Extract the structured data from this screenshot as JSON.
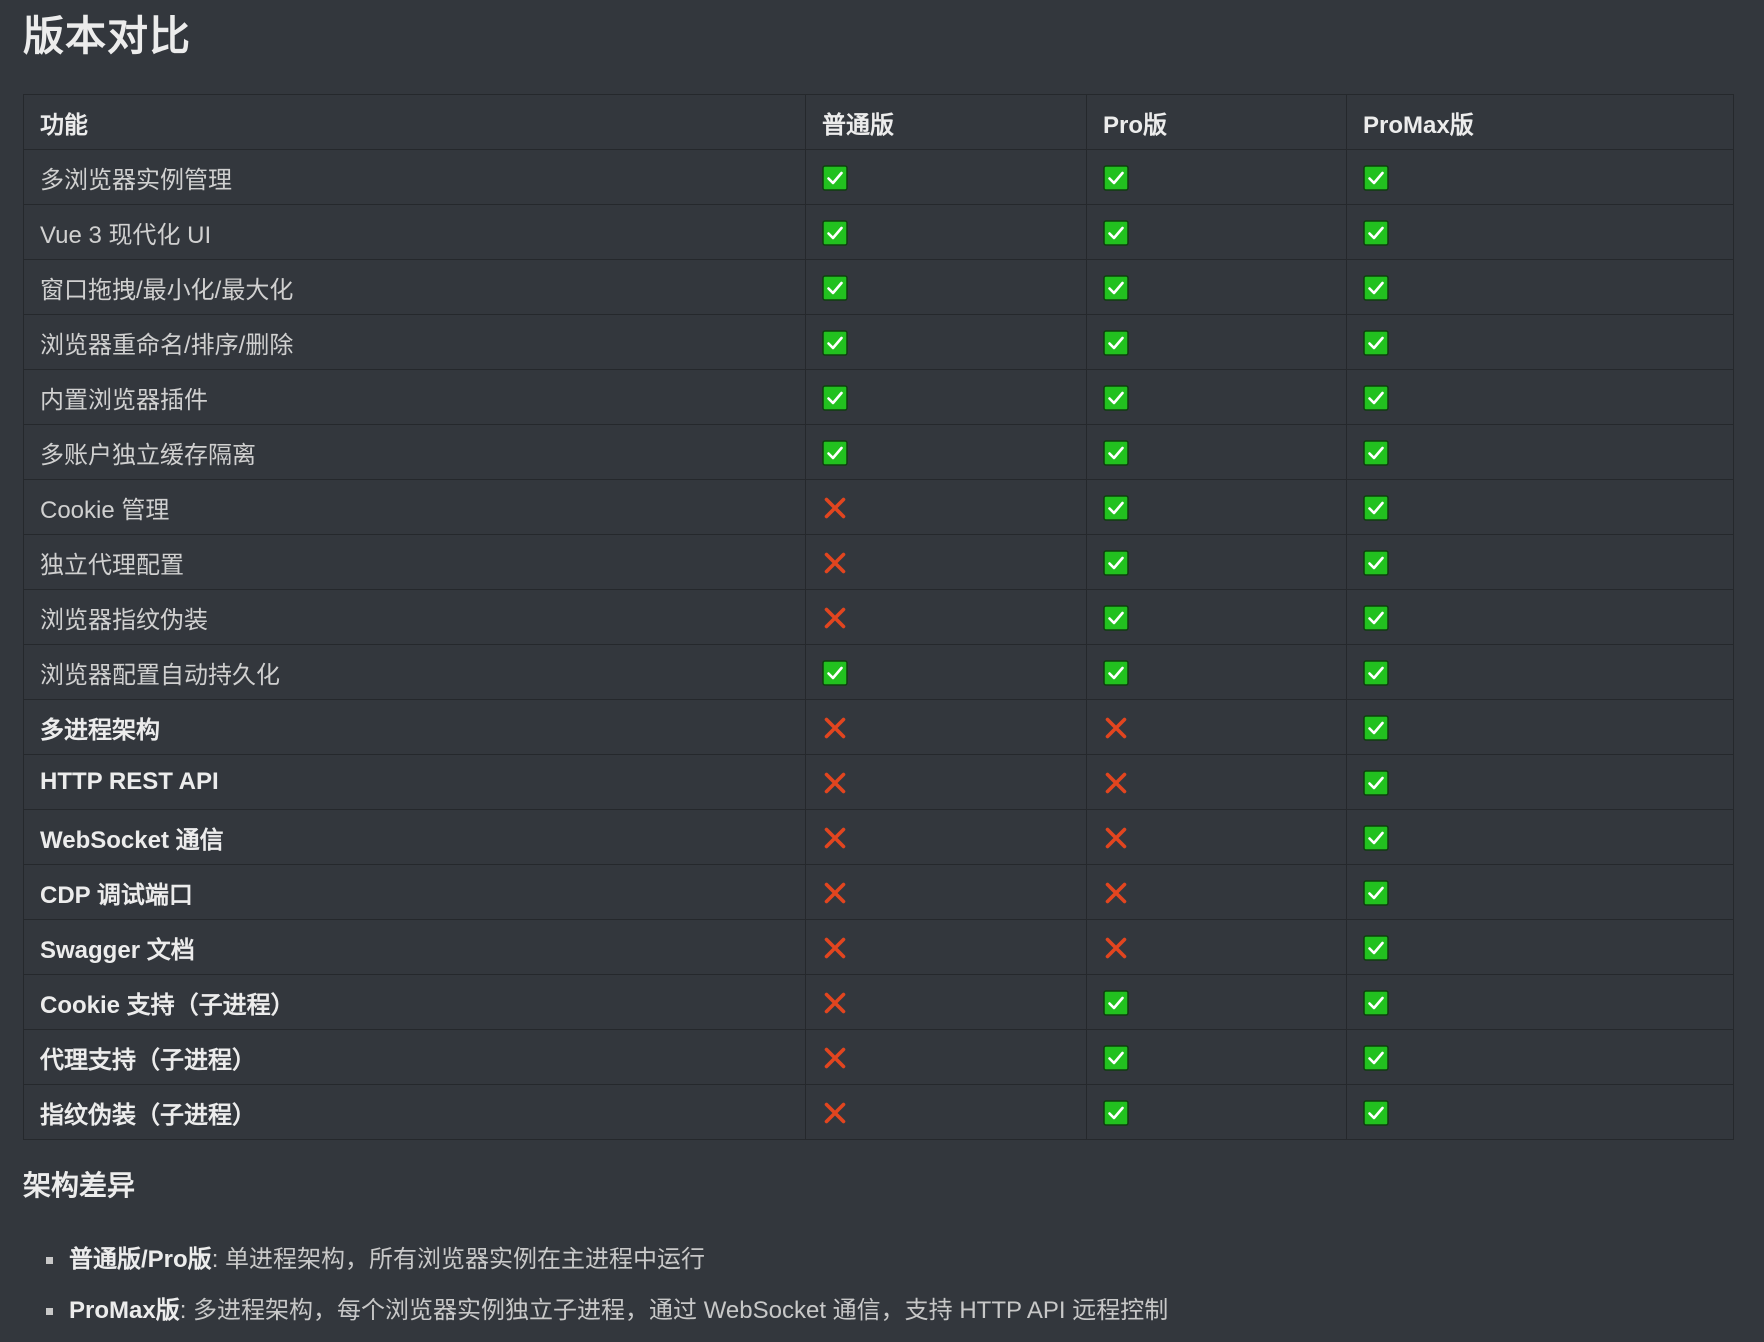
{
  "title": "版本对比",
  "table": {
    "headers": [
      "功能",
      "普通版",
      "Pro版",
      "ProMax版"
    ],
    "rows": [
      {
        "feature": "多浏览器实例管理",
        "bold": false,
        "basic": true,
        "pro": true,
        "promax": true
      },
      {
        "feature": "Vue 3 现代化 UI",
        "bold": false,
        "basic": true,
        "pro": true,
        "promax": true
      },
      {
        "feature": "窗口拖拽/最小化/最大化",
        "bold": false,
        "basic": true,
        "pro": true,
        "promax": true
      },
      {
        "feature": "浏览器重命名/排序/删除",
        "bold": false,
        "basic": true,
        "pro": true,
        "promax": true
      },
      {
        "feature": "内置浏览器插件",
        "bold": false,
        "basic": true,
        "pro": true,
        "promax": true
      },
      {
        "feature": "多账户独立缓存隔离",
        "bold": false,
        "basic": true,
        "pro": true,
        "promax": true
      },
      {
        "feature": "Cookie 管理",
        "bold": false,
        "basic": false,
        "pro": true,
        "promax": true
      },
      {
        "feature": "独立代理配置",
        "bold": false,
        "basic": false,
        "pro": true,
        "promax": true
      },
      {
        "feature": "浏览器指纹伪装",
        "bold": false,
        "basic": false,
        "pro": true,
        "promax": true
      },
      {
        "feature": "浏览器配置自动持久化",
        "bold": false,
        "basic": true,
        "pro": true,
        "promax": true
      },
      {
        "feature": "多进程架构",
        "bold": true,
        "basic": false,
        "pro": false,
        "promax": true
      },
      {
        "feature": "HTTP REST API",
        "bold": true,
        "basic": false,
        "pro": false,
        "promax": true
      },
      {
        "feature": "WebSocket 通信",
        "bold": true,
        "basic": false,
        "pro": false,
        "promax": true
      },
      {
        "feature": "CDP 调试端口",
        "bold": true,
        "basic": false,
        "pro": false,
        "promax": true
      },
      {
        "feature": "Swagger 文档",
        "bold": true,
        "basic": false,
        "pro": false,
        "promax": true
      },
      {
        "feature": "Cookie 支持（子进程）",
        "bold": true,
        "basic": false,
        "pro": true,
        "promax": true
      },
      {
        "feature": "代理支持（子进程）",
        "bold": true,
        "basic": false,
        "pro": true,
        "promax": true
      },
      {
        "feature": "指纹伪装（子进程）",
        "bold": true,
        "basic": false,
        "pro": true,
        "promax": true
      }
    ]
  },
  "icons": {
    "yes": "check-mark-button-icon",
    "no": "cross-mark-icon"
  },
  "colors": {
    "background": "#33373d",
    "check_green": "#22c11f",
    "cross_red": "#e2451f"
  },
  "architecture": {
    "heading": "架构差异",
    "items": [
      {
        "label": "普通版/Pro版",
        "text": ": 单进程架构，所有浏览器实例在主进程中运行"
      },
      {
        "label": "ProMax版",
        "text": ": 多进程架构，每个浏览器实例独立子进程，通过 WebSocket 通信，支持 HTTP API 远程控制"
      }
    ]
  }
}
